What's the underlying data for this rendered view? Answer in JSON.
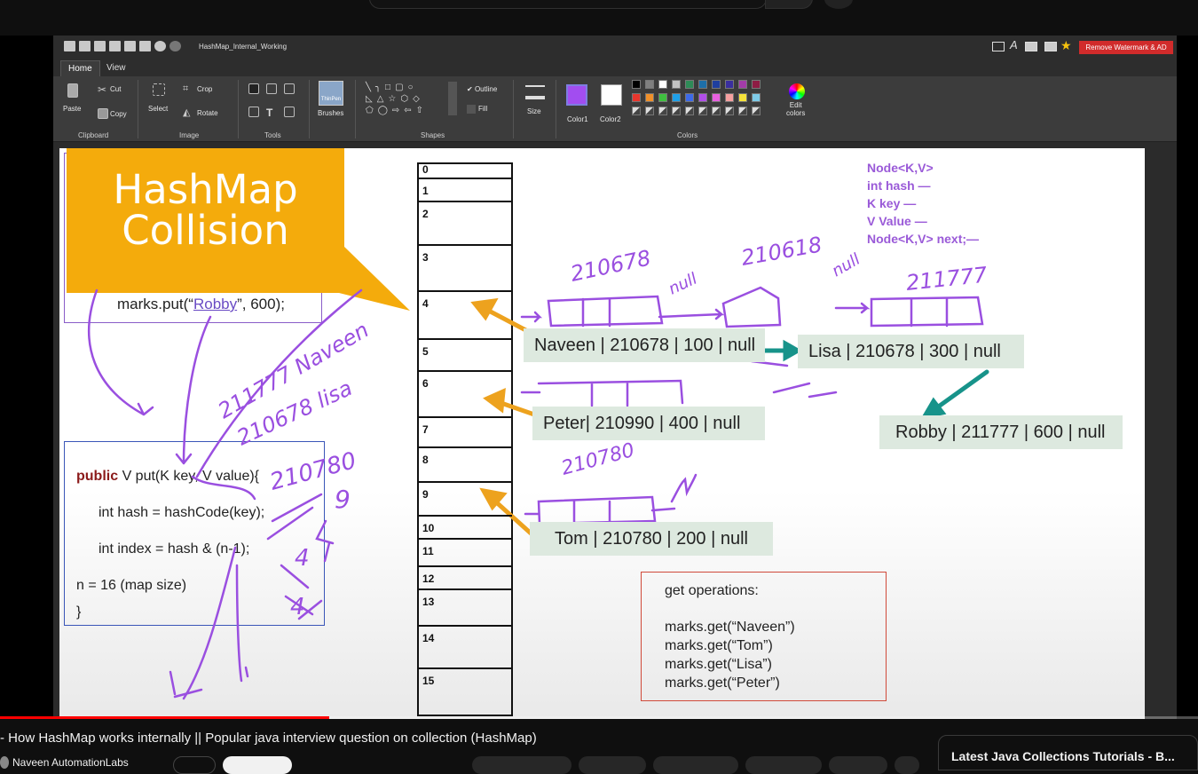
{
  "app": {
    "document_title": "HashMap_Internal_Working",
    "remove_watermark_label": "Remove Watermark & AD",
    "tabs": [
      "Home",
      "View"
    ]
  },
  "ribbon": {
    "clipboard": {
      "paste": "Paste",
      "cut": "Cut",
      "copy": "Copy",
      "group": "Clipboard"
    },
    "image": {
      "select": "Select",
      "crop": "Crop",
      "rotate": "Rotate",
      "group": "Image"
    },
    "tools": {
      "group": "Tools"
    },
    "brushes": {
      "label": "Brushes",
      "preview": "ThinPen"
    },
    "shapes": {
      "outline": "Outline",
      "fill": "Fill",
      "group": "Shapes"
    },
    "size": {
      "label": "Size"
    },
    "colors": {
      "color1": "Color1",
      "color2": "Color2",
      "edit": "Edit\ncolors",
      "group": "Colors",
      "color1_value": "#a24df0",
      "color2_value": "#ffffff",
      "palette_row1": [
        "#000000",
        "#7f7f7f",
        "#ffffff",
        "#c3c3c3",
        "#2e8b57",
        "#1e6fa8",
        "#1f3fa0",
        "#3a2f9e",
        "#a23ca8",
        "#8e1c44"
      ],
      "palette_row2": [
        "#e8362d",
        "#f0902a",
        "#3fc040",
        "#1fa0e8",
        "#3d6ae8",
        "#b04ee8",
        "#e860e0",
        "#f5a0a0",
        "#f5e23a",
        "#7ecbe8"
      ]
    }
  },
  "slide": {
    "title_line1": "HashMap",
    "title_line2": "Collision",
    "put_call": {
      "prefix": "marks.put(“",
      "key": "Robby",
      "suffix": "”, 600);"
    },
    "code": {
      "line1_kw": "public",
      "line1_rest": "V put(K key, V value){",
      "line2": "int hash = hashCode(key);",
      "line3": "int index = hash & (n-1);",
      "line4": "n = 16 (map size)",
      "line5": "}"
    },
    "buckets": [
      "0",
      "1",
      "2",
      "3",
      "4",
      "5",
      "6",
      "7",
      "8",
      "9",
      "10",
      "11",
      "12",
      "13",
      "14",
      "15"
    ],
    "nodes": {
      "naveen": "Naveen | 210678 | 100 | null",
      "lisa": "Lisa | 210678 | 300 | null",
      "peter": "Peter| 210990 | 400 | null",
      "robby": "Robby | 211777 | 600 | null",
      "tom": "Tom | 210780 | 200 | null"
    },
    "node_class": [
      "Node<K,V>",
      "int hash",
      "K key",
      "V Value",
      "Node<K,V> next;"
    ],
    "get_ops": {
      "title": "get operations:",
      "lines": [
        "marks.get(“Naveen”)",
        "marks.get(“Tom”)",
        "marks.get(“Lisa”)",
        "marks.get(“Peter”)"
      ]
    },
    "handwriting": [
      "210678",
      "210618",
      "null",
      "211777",
      "210780",
      "null",
      "211777 Naveen",
      "210678 lisa",
      "210780",
      "9",
      "4",
      "4"
    ]
  },
  "player": {
    "progress_fraction": 0.275
  },
  "below": {
    "video_title": "- How HashMap works internally || Popular java interview question on collection (HashMap)",
    "channel": "Naveen AutomationLabs",
    "sidebar_title": "Latest Java Collections Tutorials - B..."
  }
}
